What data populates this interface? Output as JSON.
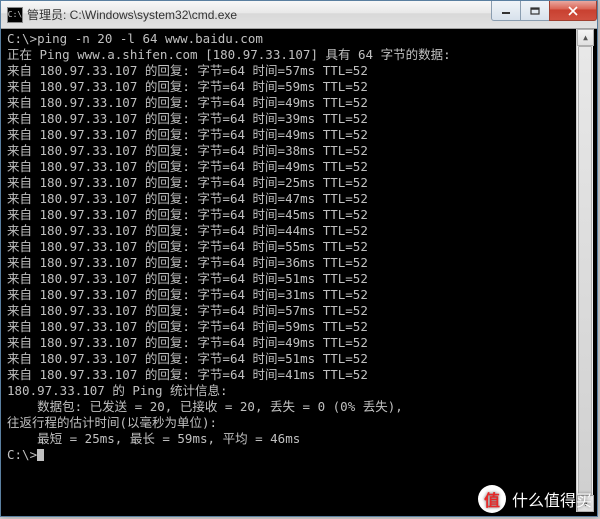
{
  "window": {
    "icon_text": "C:\\",
    "title": "管理员: C:\\Windows\\system32\\cmd.exe"
  },
  "terminal": {
    "prompt_cmd": "C:\\>ping -n 20 -l 64 www.baidu.com",
    "blank1": "",
    "header": "正在 Ping www.a.shifen.com [180.97.33.107] 具有 64 字节的数据:",
    "replies": [
      "来自 180.97.33.107 的回复: 字节=64 时间=57ms TTL=52",
      "来自 180.97.33.107 的回复: 字节=64 时间=59ms TTL=52",
      "来自 180.97.33.107 的回复: 字节=64 时间=49ms TTL=52",
      "来自 180.97.33.107 的回复: 字节=64 时间=39ms TTL=52",
      "来自 180.97.33.107 的回复: 字节=64 时间=49ms TTL=52",
      "来自 180.97.33.107 的回复: 字节=64 时间=38ms TTL=52",
      "来自 180.97.33.107 的回复: 字节=64 时间=49ms TTL=52",
      "来自 180.97.33.107 的回复: 字节=64 时间=25ms TTL=52",
      "来自 180.97.33.107 的回复: 字节=64 时间=47ms TTL=52",
      "来自 180.97.33.107 的回复: 字节=64 时间=45ms TTL=52",
      "来自 180.97.33.107 的回复: 字节=64 时间=44ms TTL=52",
      "来自 180.97.33.107 的回复: 字节=64 时间=55ms TTL=52",
      "来自 180.97.33.107 的回复: 字节=64 时间=36ms TTL=52",
      "来自 180.97.33.107 的回复: 字节=64 时间=51ms TTL=52",
      "来自 180.97.33.107 的回复: 字节=64 时间=31ms TTL=52",
      "来自 180.97.33.107 的回复: 字节=64 时间=57ms TTL=52",
      "来自 180.97.33.107 的回复: 字节=64 时间=59ms TTL=52",
      "来自 180.97.33.107 的回复: 字节=64 时间=49ms TTL=52",
      "来自 180.97.33.107 的回复: 字节=64 时间=51ms TTL=52",
      "来自 180.97.33.107 的回复: 字节=64 时间=41ms TTL=52"
    ],
    "blank2": "",
    "stats_header": "180.97.33.107 的 Ping 统计信息:",
    "stats_packets": "    数据包: 已发送 = 20, 已接收 = 20, 丢失 = 0 (0% 丢失),",
    "stats_rtt_header": "往返行程的估计时间(以毫秒为单位):",
    "stats_rtt": "    最短 = 25ms, 最长 = 59ms, 平均 = 46ms",
    "blank3": "",
    "prompt_end": "C:\\>"
  },
  "watermark": {
    "badge": "值",
    "text": "什么值得买"
  }
}
